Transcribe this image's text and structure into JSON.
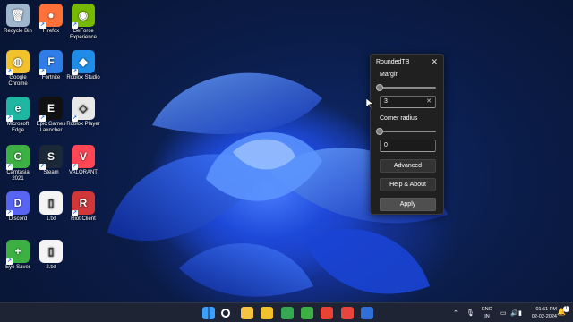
{
  "desktop_icons": [
    {
      "label": "Recycle Bin",
      "icon": "recycle-bin-icon",
      "color": "#9fb6cc"
    },
    {
      "label": "Firefox",
      "icon": "firefox-icon",
      "color": "#ff7139"
    },
    {
      "label": "GeForce Experience",
      "icon": "geforce-icon",
      "color": "#76b900"
    },
    {
      "label": "Google Chrome",
      "icon": "chrome-icon",
      "color": "#f2c12e"
    },
    {
      "label": "Fortnite",
      "icon": "fortnite-icon",
      "color": "#2f7ee8"
    },
    {
      "label": "Roblox Studio",
      "icon": "roblox-studio-icon",
      "color": "#1f8ce8"
    },
    {
      "label": "Microsoft Edge",
      "icon": "edge-icon",
      "color": "#1fb6a2"
    },
    {
      "label": "Epic Games Launcher",
      "icon": "epic-games-icon",
      "color": "#111111"
    },
    {
      "label": "Roblox Player",
      "icon": "roblox-player-icon",
      "color": "#e8e8e8"
    },
    {
      "label": "Camtasia 2021",
      "icon": "camtasia-icon",
      "color": "#3cb043"
    },
    {
      "label": "Steam",
      "icon": "steam-icon",
      "color": "#1b2838"
    },
    {
      "label": "VALORANT",
      "icon": "valorant-icon",
      "color": "#ff4655"
    },
    {
      "label": "Discord",
      "icon": "discord-icon",
      "color": "#5865f2"
    },
    {
      "label": "1.txt",
      "icon": "text-file-icon",
      "color": "#f4f4f4"
    },
    {
      "label": "Riot Client",
      "icon": "riot-client-icon",
      "color": "#d13639"
    },
    {
      "label": "Eye Saver",
      "icon": "eye-saver-icon",
      "color": "#3cb043"
    },
    {
      "label": "2.txt",
      "icon": "text-file-icon",
      "color": "#f4f4f4"
    }
  ],
  "dialog": {
    "title": "RoundedTB",
    "close_glyph": "✕",
    "margin_label": "Margin",
    "margin_slider_value": 0,
    "margin_value": "3",
    "clear_glyph": "✕",
    "corner_label": "Corner radius",
    "corner_slider_value": 0,
    "corner_value": "0",
    "advanced_label": "Advanced",
    "help_label": "Help & About",
    "apply_label": "Apply"
  },
  "taskbar": {
    "apps": [
      {
        "icon": "start-icon",
        "color": "#3aa0ff"
      },
      {
        "icon": "search-icon",
        "color": "#ffffff"
      },
      {
        "icon": "file-explorer-icon",
        "color": "#f6c343"
      },
      {
        "icon": "chrome-icon",
        "color": "#f2c12e"
      },
      {
        "icon": "chrome-icon",
        "color": "#34a853"
      },
      {
        "icon": "camtasia-icon",
        "color": "#3cb043"
      },
      {
        "icon": "chrome-icon",
        "color": "#ea4335"
      },
      {
        "icon": "camtasia-recorder-icon",
        "color": "#e8453c"
      },
      {
        "icon": "roundedtb-icon",
        "color": "#2f6fd6"
      }
    ],
    "lang_top": "ENG",
    "lang_bottom": "IN",
    "time": "01:51 PM",
    "date": "02-02-2024",
    "notification_badge": "1"
  }
}
